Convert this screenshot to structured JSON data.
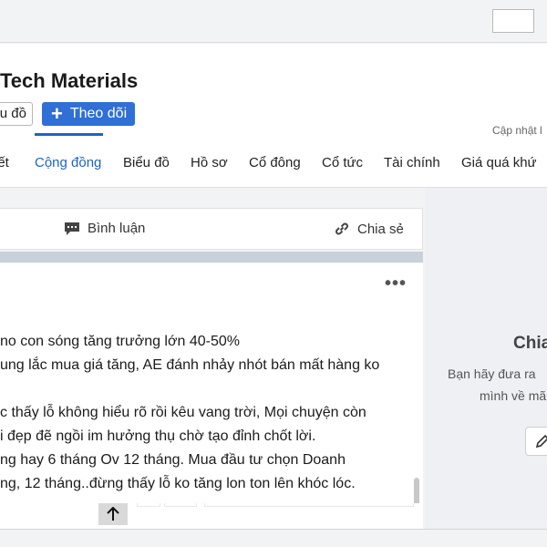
{
  "header": {
    "company_name": "Tech Materials",
    "chart_button_label": "u đồ",
    "follow_button_label": "Theo dõi",
    "updated_text": "Cập nhật l"
  },
  "tabs": [
    {
      "label": "iết",
      "active": false
    },
    {
      "label": "Cộng đồng",
      "active": true
    },
    {
      "label": "Biểu đồ",
      "active": false
    },
    {
      "label": "Hồ sơ",
      "active": false
    },
    {
      "label": "Cổ đông",
      "active": false
    },
    {
      "label": "Cổ tức",
      "active": false
    },
    {
      "label": "Tài chính",
      "active": false
    },
    {
      "label": "Giá quá khứ",
      "active": false
    }
  ],
  "post": {
    "comment_label": "Bình luận",
    "share_label": "Chia sẻ",
    "more_label": "•••",
    "lines": [
      "no con sóng tăng trưởng lớn 40-50%",
      "ung lắc mua giá tăng, AE đánh nhảy nhót bán mất hàng ko",
      "",
      "c thấy lỗ không hiểu rõ rồi kêu vang trời, Mọi chuyện còn",
      "i đẹp đẽ ngồi im hưởng thụ chờ tạo đỉnh chốt lời.",
      "ng hay 6 tháng Ov 12 tháng. Mua đầu tư chọn Doanh",
      "ng, 12 tháng..đừng thấy lỗ ko tăng lon ton lên khóc lóc."
    ]
  },
  "side_panel": {
    "title": "Chia",
    "line1": "Bạn hãy đưa ra",
    "line2": "mình về mã"
  },
  "colors": {
    "accent": "#1f63c6",
    "follow_button": "#2f6fd6"
  }
}
